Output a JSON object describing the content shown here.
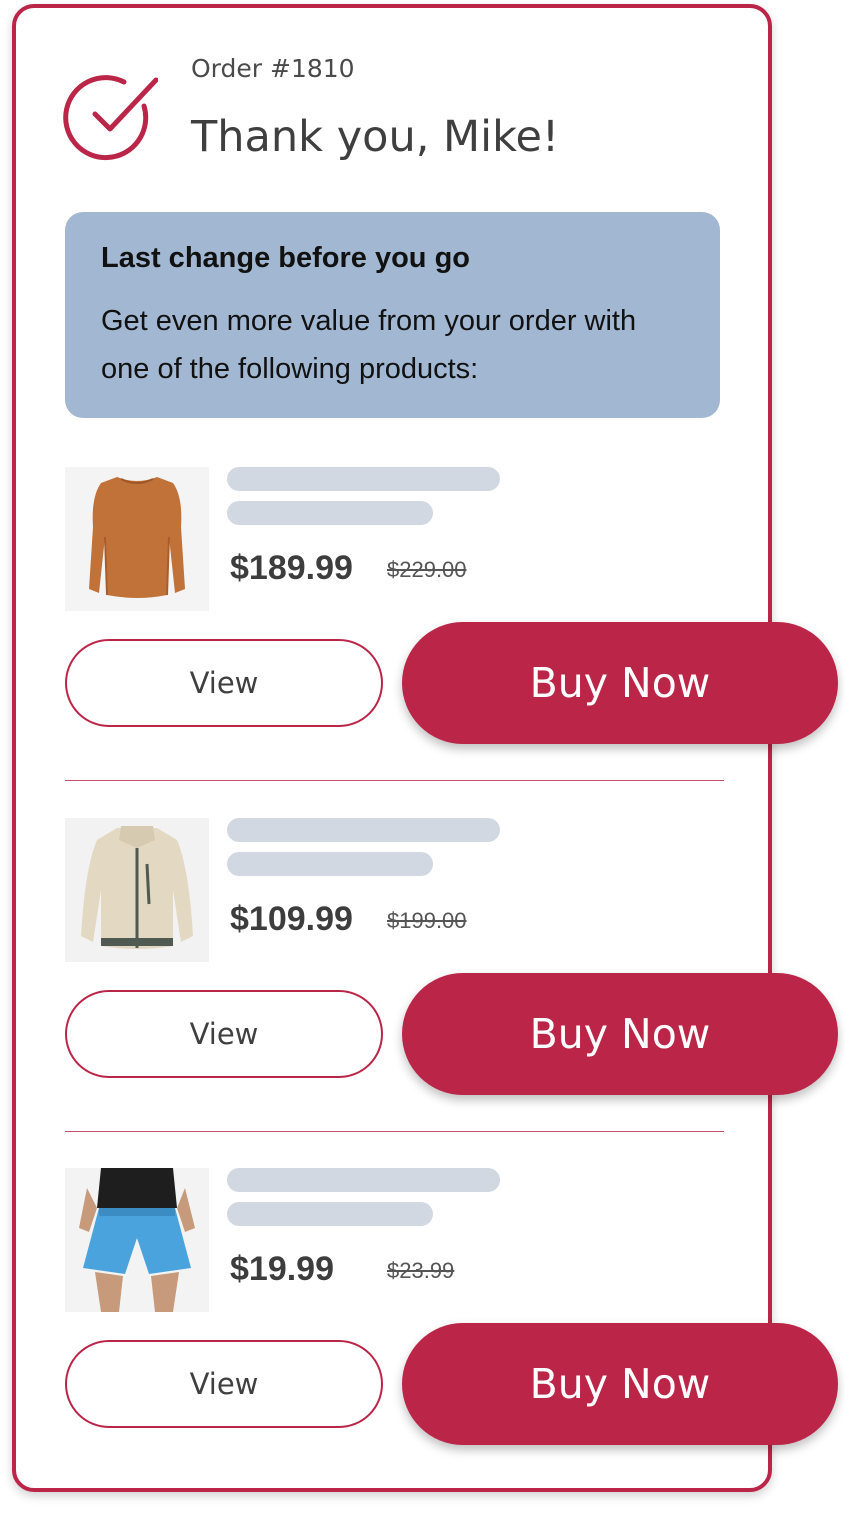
{
  "header": {
    "order_label": "Order #1810",
    "greeting": "Thank you, Mike!"
  },
  "promo": {
    "title": "Last change before you go",
    "body": "Get even more value from your order with one of the following products:"
  },
  "products": [
    {
      "price": "$189.99",
      "original_price": "$229.00",
      "view_label": "View",
      "buy_label": "Buy Now",
      "image": "orange-long-sleeve-shirt"
    },
    {
      "price": "$109.99",
      "original_price": "$199.00",
      "view_label": "View",
      "buy_label": "Buy Now",
      "image": "beige-fleece-jacket"
    },
    {
      "price": "$19.99",
      "original_price": "$23.99",
      "view_label": "View",
      "buy_label": "Buy Now",
      "image": "blue-shorts"
    }
  ],
  "colors": {
    "accent": "#bb2547",
    "promo_background": "#a1b7d2",
    "skeleton": "#d2d8e1"
  }
}
